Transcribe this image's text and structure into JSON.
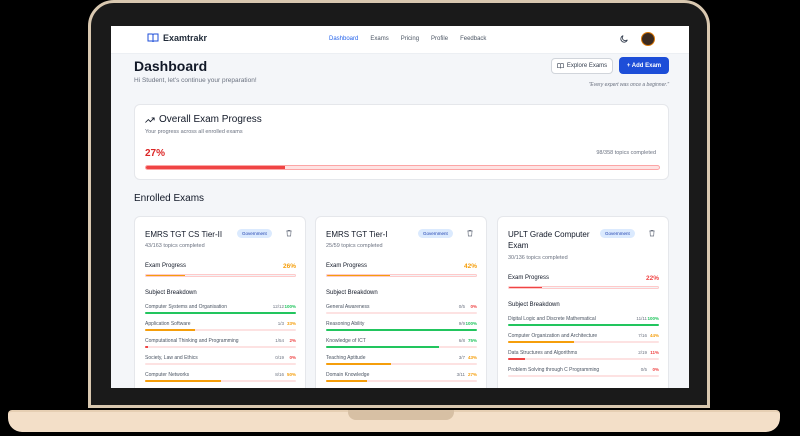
{
  "nav": {
    "brand": "Examtrakr",
    "links": [
      "Dashboard",
      "Exams",
      "Pricing",
      "Profile",
      "Feedback"
    ]
  },
  "header": {
    "title": "Dashboard",
    "greeting": "Hi Student, let's continue your preparation!",
    "explore_label": "Explore Exams",
    "add_label": "+ Add Exam",
    "quote": "\"Every expert was once a beginner.\""
  },
  "overall": {
    "title": "Overall Exam Progress",
    "subtitle": "Your progress across all enrolled exams",
    "percent_text": "27%",
    "percent": 27,
    "count_text": "98/358 topics completed"
  },
  "section_title": "Enrolled Exams",
  "labels": {
    "exam_progress": "Exam Progress",
    "subject_breakdown": "Subject Breakdown"
  },
  "colors": {
    "red": "#ef4444",
    "orange": "#f59e0b",
    "green": "#22c55e",
    "blue": "#1d4ed8"
  },
  "exams": [
    {
      "name": "EMRS TGT CS Tier-II",
      "badge": "Government",
      "topics": "43/163 topics completed",
      "progress_text": "26%",
      "progress": 26,
      "subjects": [
        {
          "name": "Computer Systems and Organisation",
          "count": "12/12",
          "pct_text": "100%",
          "pct": 100
        },
        {
          "name": "Application Software",
          "count": "1/3",
          "pct_text": "33%",
          "pct": 33
        },
        {
          "name": "Computational Thinking and Programming",
          "count": "1/54",
          "pct_text": "2%",
          "pct": 2
        },
        {
          "name": "Society, Law and Ethics",
          "count": "0/19",
          "pct_text": "0%",
          "pct": 0
        },
        {
          "name": "Computer Networks",
          "count": "8/16",
          "pct_text": "50%",
          "pct": 50
        }
      ]
    },
    {
      "name": "EMRS TGT Tier-I",
      "badge": "Government",
      "topics": "25/59 topics completed",
      "progress_text": "42%",
      "progress": 42,
      "subjects": [
        {
          "name": "General Awareness",
          "count": "0/5",
          "pct_text": "0%",
          "pct": 0
        },
        {
          "name": "Reasoning Ability",
          "count": "9/9",
          "pct_text": "100%",
          "pct": 100
        },
        {
          "name": "Knowledge of ICT",
          "count": "6/8",
          "pct_text": "75%",
          "pct": 75
        },
        {
          "name": "Teaching Aptitude",
          "count": "3/7",
          "pct_text": "43%",
          "pct": 43
        },
        {
          "name": "Domain Knowledge",
          "count": "3/11",
          "pct_text": "27%",
          "pct": 27
        }
      ]
    },
    {
      "name": "UPLT Grade Computer Exam",
      "badge": "Government",
      "topics": "30/136 topics completed",
      "progress_text": "22%",
      "progress": 22,
      "subjects": [
        {
          "name": "Digital Logic and Discrete Mathematical",
          "count": "11/11",
          "pct_text": "100%",
          "pct": 100
        },
        {
          "name": "Computer Organization and Architecture",
          "count": "7/16",
          "pct_text": "44%",
          "pct": 44
        },
        {
          "name": "Data Structures and Algorithms",
          "count": "2/19",
          "pct_text": "11%",
          "pct": 11
        },
        {
          "name": "Problem Solving through C Programming",
          "count": "0/5",
          "pct_text": "0%",
          "pct": 0
        }
      ]
    }
  ]
}
